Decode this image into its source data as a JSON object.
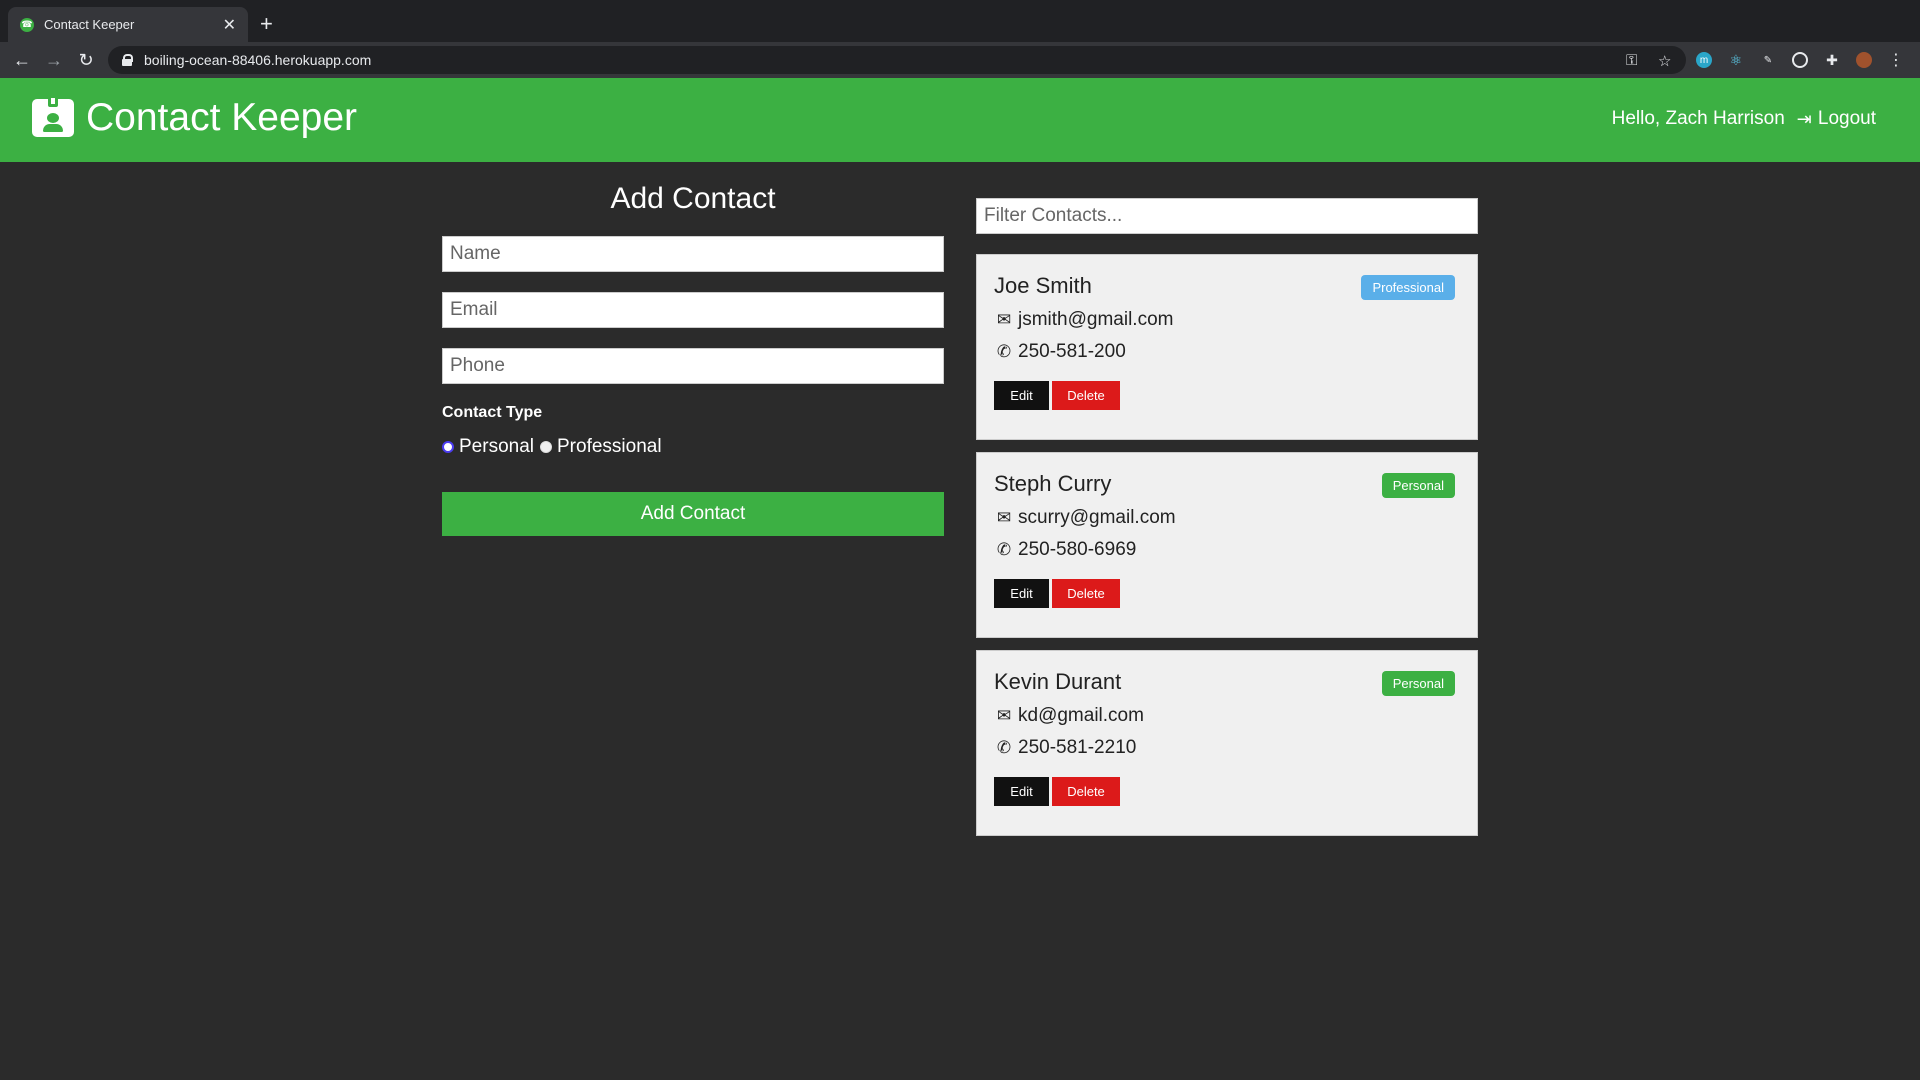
{
  "browser": {
    "tab_title": "Contact Keeper",
    "url": "boiling-ocean-88406.herokuapp.com"
  },
  "navbar": {
    "brand": "Contact Keeper",
    "greeting": "Hello, Zach Harrison",
    "logout_label": "Logout",
    "color": "#3cb043"
  },
  "form": {
    "title": "Add Contact",
    "name_placeholder": "Name",
    "email_placeholder": "Email",
    "phone_placeholder": "Phone",
    "type_label": "Contact Type",
    "option_personal": "Personal",
    "option_professional": "Professional",
    "selected_type": "Personal",
    "submit_label": "Add Contact"
  },
  "filter": {
    "placeholder": "Filter Contacts..."
  },
  "contacts": [
    {
      "name": "Joe Smith",
      "email": "jsmith@gmail.com",
      "phone": "250-581-200",
      "type": "Professional",
      "type_color": "#5aafe9"
    },
    {
      "name": "Steph Curry",
      "email": "scurry@gmail.com",
      "phone": "250-580-6969",
      "type": "Personal",
      "type_color": "#3cb043"
    },
    {
      "name": "Kevin Durant",
      "email": "kd@gmail.com",
      "phone": "250-581-2210",
      "type": "Personal",
      "type_color": "#3cb043"
    }
  ],
  "card_actions": {
    "edit_label": "Edit",
    "delete_label": "Delete"
  }
}
